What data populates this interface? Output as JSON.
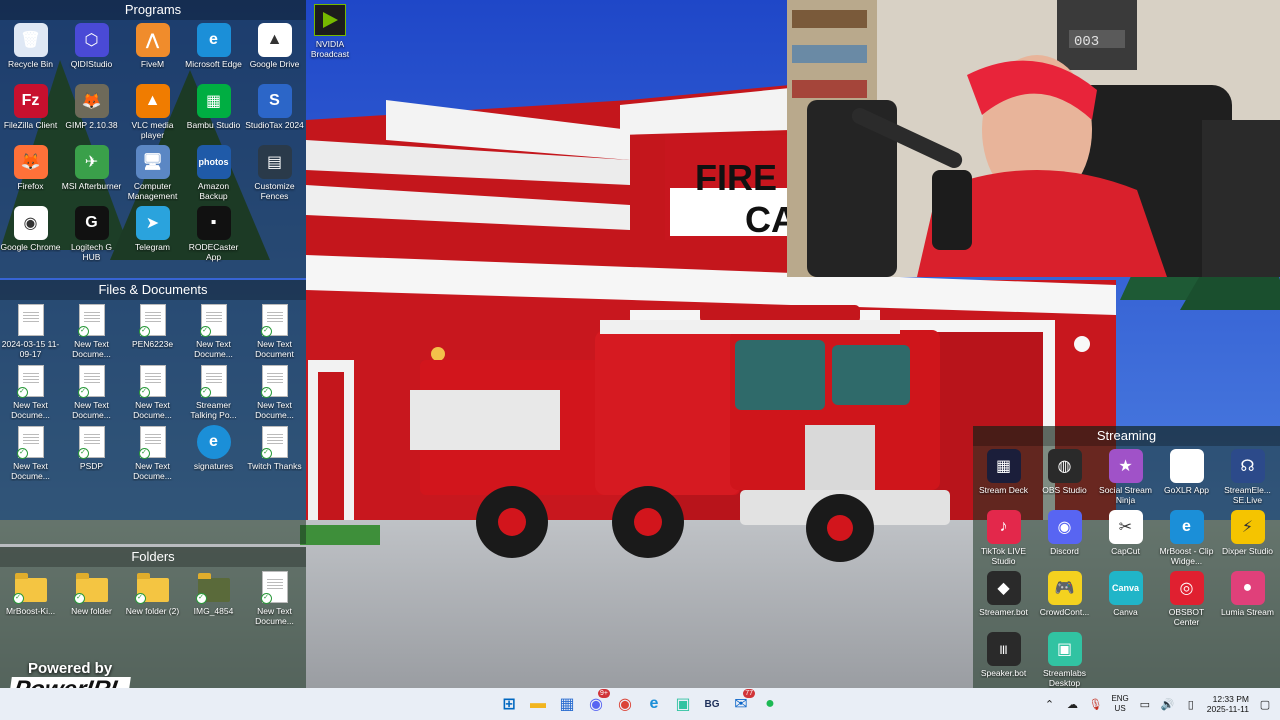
{
  "fences": {
    "programs": {
      "title": "Programs",
      "items": [
        {
          "label": "Recycle Bin",
          "icon": "recycle-bin-icon",
          "color": "#dfe8f5",
          "glyph": "🗑"
        },
        {
          "label": "QIDIStudio",
          "icon": "qidistudio-icon",
          "color": "#4a4ad6",
          "glyph": "⬡"
        },
        {
          "label": "FiveM",
          "icon": "fivem-icon",
          "color": "#f08c2c",
          "glyph": "⋀"
        },
        {
          "label": "Microsoft Edge",
          "icon": "edge-icon",
          "color": "#1b8fd8",
          "glyph": "e"
        },
        {
          "label": "Google Drive",
          "icon": "google-drive-icon",
          "color": "#ffffff",
          "glyph": "▲"
        },
        {
          "label": "FileZilla Client",
          "icon": "filezilla-icon",
          "color": "#c8102e",
          "glyph": "Fz"
        },
        {
          "label": "GIMP 2.10.38",
          "icon": "gimp-icon",
          "color": "#6e6a5a",
          "glyph": "🦊"
        },
        {
          "label": "VLC media player",
          "icon": "vlc-icon",
          "color": "#f07c00",
          "glyph": "▲"
        },
        {
          "label": "Bambu Studio",
          "icon": "bambu-studio-icon",
          "color": "#00ae42",
          "glyph": "▦"
        },
        {
          "label": "StudioTax 2024",
          "icon": "studiotax-icon",
          "color": "#2c66c8",
          "glyph": "S"
        },
        {
          "label": "Firefox",
          "icon": "firefox-icon",
          "color": "#ff7139",
          "glyph": "🦊"
        },
        {
          "label": "MSI Afterburner",
          "icon": "msi-afterburner-icon",
          "color": "#3aa04a",
          "glyph": "✈"
        },
        {
          "label": "Computer Management",
          "icon": "computer-management-icon",
          "color": "#5b87c4",
          "glyph": "🖥"
        },
        {
          "label": "Amazon Backup",
          "icon": "amazon-photos-icon",
          "color": "#1f5aa8",
          "glyph": "photos"
        },
        {
          "label": "Customize Fences",
          "icon": "customize-fences-icon",
          "color": "#2a3a4a",
          "glyph": "▤"
        },
        {
          "label": "Google Chrome",
          "icon": "chrome-icon",
          "color": "#ffffff",
          "glyph": "◉"
        },
        {
          "label": "Logitech G HUB",
          "icon": "logitech-ghub-icon",
          "color": "#111111",
          "glyph": "G"
        },
        {
          "label": "Telegram",
          "icon": "telegram-icon",
          "color": "#2aa3dd",
          "glyph": "➤"
        },
        {
          "label": "RODECaster App",
          "icon": "rodecaster-icon",
          "color": "#111111",
          "glyph": "▪"
        }
      ]
    },
    "files": {
      "title": "Files & Documents",
      "items": [
        {
          "label": "2024-03-15 11-09-17",
          "icon": "document-icon"
        },
        {
          "label": "New Text Docume...",
          "icon": "text-document-icon"
        },
        {
          "label": "PEN6223e",
          "icon": "chrome-document-icon"
        },
        {
          "label": "New Text Docume...",
          "icon": "text-document-icon"
        },
        {
          "label": "New Text Document",
          "icon": "text-document-icon"
        },
        {
          "label": "New Text Docume...",
          "icon": "text-document-icon"
        },
        {
          "label": "New Text Docume...",
          "icon": "text-document-icon"
        },
        {
          "label": "New Text Docume...",
          "icon": "text-document-icon"
        },
        {
          "label": "Streamer Talking Po...",
          "icon": "text-document-icon"
        },
        {
          "label": "New Text Docume...",
          "icon": "text-document-icon"
        },
        {
          "label": "New Text Docume...",
          "icon": "text-document-icon"
        },
        {
          "label": "PSDP",
          "icon": "text-document-icon"
        },
        {
          "label": "New Text Docume...",
          "icon": "text-document-icon"
        },
        {
          "label": "signatures",
          "icon": "edge-icon"
        },
        {
          "label": "Twitch Thanks",
          "icon": "text-document-icon"
        }
      ]
    },
    "folders": {
      "title": "Folders",
      "items": [
        {
          "label": "MrBoost-Ki...",
          "icon": "folder-icon"
        },
        {
          "label": "New folder",
          "icon": "folder-icon"
        },
        {
          "label": "New folder (2)",
          "icon": "folder-icon"
        },
        {
          "label": "IMG_4854",
          "icon": "image-icon"
        },
        {
          "label": "New Text Docume...",
          "icon": "text-document-icon"
        }
      ]
    },
    "streaming": {
      "title": "Streaming",
      "items": [
        {
          "label": "Stream Deck",
          "icon": "stream-deck-icon",
          "color": "#1b1e3a",
          "glyph": "▦"
        },
        {
          "label": "OBS Studio",
          "icon": "obs-studio-icon",
          "color": "#2a2a2a",
          "glyph": "◍"
        },
        {
          "label": "Social Stream Ninja",
          "icon": "social-stream-ninja-icon",
          "color": "#a052c8",
          "glyph": "★"
        },
        {
          "label": "GoXLR App",
          "icon": "goxlr-icon",
          "color": "#ffffff",
          "glyph": ""
        },
        {
          "label": "StreamEle... SE.Live",
          "icon": "streamelements-icon",
          "color": "#2c4a8a",
          "glyph": "☊"
        },
        {
          "label": "TikTok LIVE Studio",
          "icon": "tiktok-live-icon",
          "color": "#e3284b",
          "glyph": "♪"
        },
        {
          "label": "Discord",
          "icon": "discord-icon",
          "color": "#5865f2",
          "glyph": "◉"
        },
        {
          "label": "CapCut",
          "icon": "capcut-icon",
          "color": "#ffffff",
          "glyph": "✂"
        },
        {
          "label": "MrBoost - Clip Widge...",
          "icon": "edge-icon",
          "color": "#1b8fd8",
          "glyph": "e"
        },
        {
          "label": "Dixper Studio",
          "icon": "dixper-icon",
          "color": "#f5c400",
          "glyph": "⚡"
        },
        {
          "label": "Streamer.bot",
          "icon": "streamer-bot-icon",
          "color": "#2a2a2a",
          "glyph": "◆"
        },
        {
          "label": "CrowdCont...",
          "icon": "crowdcontrol-icon",
          "color": "#f4d21f",
          "glyph": "🎮"
        },
        {
          "label": "Canva",
          "icon": "canva-icon",
          "color": "#20b5c8",
          "glyph": "Canva"
        },
        {
          "label": "OBSBOT Center",
          "icon": "obsbot-icon",
          "color": "#e02030",
          "glyph": "◎"
        },
        {
          "label": "Lumia Stream",
          "icon": "lumia-stream-icon",
          "color": "#e0407a",
          "glyph": "●"
        },
        {
          "label": "Speaker.bot",
          "icon": "speaker-bot-icon",
          "color": "#2a2a2a",
          "glyph": "|||"
        },
        {
          "label": "Streamlabs Desktop",
          "icon": "streamlabs-icon",
          "color": "#31c3a2",
          "glyph": "▣"
        }
      ]
    }
  },
  "desktop": {
    "nvidia_label": "NVIDIA Broadcast",
    "sign_line1": "FIRE",
    "sign_line2": "CA",
    "powered_line1": "Powered by",
    "powered_line2": "PowerIRL",
    "webcam_counter": "003"
  },
  "taskbar": {
    "apps": [
      {
        "name": "start-button",
        "glyph": "⊞",
        "color": "#0067c0"
      },
      {
        "name": "file-explorer-icon",
        "glyph": "▬",
        "color": "#f2b51f"
      },
      {
        "name": "microsoft-store-icon",
        "glyph": "▦",
        "color": "#2a6dd0"
      },
      {
        "name": "discord-taskbar-icon",
        "glyph": "◉",
        "color": "#5865f2",
        "badge": "9+"
      },
      {
        "name": "chrome-taskbar-icon",
        "glyph": "◉",
        "color": "#db4437"
      },
      {
        "name": "edge-taskbar-icon",
        "glyph": "e",
        "color": "#1b8fd8"
      },
      {
        "name": "streamlabs-taskbar-icon",
        "glyph": "▣",
        "color": "#31c3a2"
      },
      {
        "name": "bg-taskbar-icon",
        "glyph": "BG",
        "color": "#1d2f5a"
      },
      {
        "name": "outlook-taskbar-icon",
        "glyph": "✉",
        "color": "#0a64c8",
        "badge": "77"
      },
      {
        "name": "spotify-taskbar-icon",
        "glyph": "●",
        "color": "#1db954"
      }
    ],
    "lang_line1": "ENG",
    "lang_line2": "US",
    "time": "12:33 PM",
    "date": "2025-11-11"
  }
}
